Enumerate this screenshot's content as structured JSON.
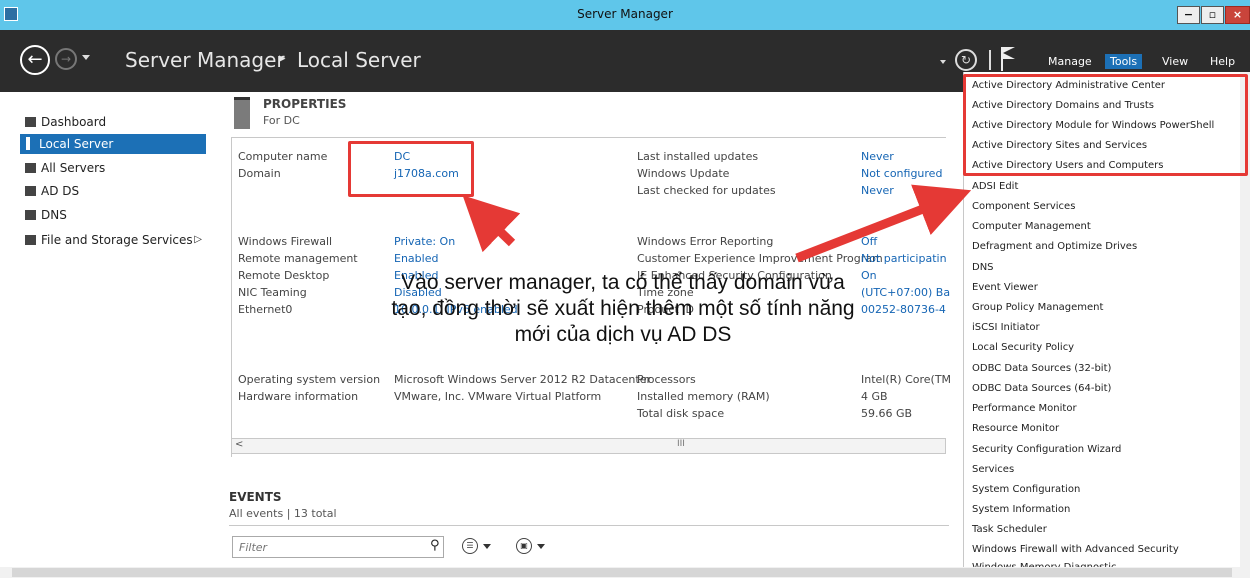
{
  "window": {
    "title": "Server Manager",
    "min": "−",
    "max": "▫",
    "close": "×"
  },
  "header": {
    "breadcrumb_root": "Server Manager",
    "breadcrumb_sep": "▸",
    "breadcrumb_page": "Local Server",
    "menus": [
      "Manage",
      "Tools",
      "View",
      "Help"
    ]
  },
  "sidebar": {
    "items": [
      {
        "label": "Dashboard",
        "icon": "dashboard-icon"
      },
      {
        "label": "Local Server",
        "icon": "server-icon",
        "active": true
      },
      {
        "label": "All Servers",
        "icon": "servers-icon"
      },
      {
        "label": "AD DS",
        "icon": "ad-ds-icon"
      },
      {
        "label": "DNS",
        "icon": "dns-icon"
      },
      {
        "label": "File and Storage Services",
        "icon": "storage-icon",
        "arrow": "▷"
      }
    ]
  },
  "properties": {
    "title": "PROPERTIES",
    "subtitle": "For DC",
    "left": [
      {
        "label": "Computer name",
        "value": "DC"
      },
      {
        "label": "Domain",
        "value": "j1708a.com"
      },
      {
        "label": "Windows Firewall",
        "value": "Private: On"
      },
      {
        "label": "Remote management",
        "value": "Enabled"
      },
      {
        "label": "Remote Desktop",
        "value": "Enabled"
      },
      {
        "label": "NIC Teaming",
        "value": "Disabled"
      },
      {
        "label": "Ethernet0",
        "value": "10.0.0.1, IPv6 enabled"
      },
      {
        "label": "Operating system version",
        "value": "Microsoft Windows Server 2012 R2 Datacenter"
      },
      {
        "label": "Hardware information",
        "value": "VMware, Inc. VMware Virtual Platform"
      }
    ],
    "right": [
      {
        "label": "Last installed updates",
        "value": "Never"
      },
      {
        "label": "Windows Update",
        "value": "Not configured"
      },
      {
        "label": "Last checked for updates",
        "value": "Never"
      },
      {
        "label": "Windows Error Reporting",
        "value": "Off"
      },
      {
        "label": "Customer Experience Improvement Program",
        "value": "Not participatin"
      },
      {
        "label": "IE Enhanced Security Configuration",
        "value": "On"
      },
      {
        "label": "Time zone",
        "value": "(UTC+07:00) Ba"
      },
      {
        "label": "Product ID",
        "value": "00252-80736-4"
      },
      {
        "label": "Processors",
        "value": "Intel(R) Core(TM"
      },
      {
        "label": "Installed memory (RAM)",
        "value": "4 GB"
      },
      {
        "label": "Total disk space",
        "value": "59.66 GB"
      }
    ],
    "scroll_left": "<",
    "scroll_mid": "III"
  },
  "events": {
    "title": "EVENTS",
    "subtitle": "All events | 13 total",
    "filter_placeholder": "Filter"
  },
  "tools_menu": [
    "Active Directory Administrative Center",
    "Active Directory Domains and Trusts",
    "Active Directory Module for Windows PowerShell",
    "Active Directory Sites and Services",
    "Active Directory Users and Computers",
    "ADSI Edit",
    "Component Services",
    "Computer Management",
    "Defragment and Optimize Drives",
    "DNS",
    "Event Viewer",
    "Group Policy Management",
    "iSCSI Initiator",
    "Local Security Policy",
    "ODBC Data Sources (32-bit)",
    "ODBC Data Sources (64-bit)",
    "Performance Monitor",
    "Resource Monitor",
    "Security Configuration Wizard",
    "Services",
    "System Configuration",
    "System Information",
    "Task Scheduler",
    "Windows Firewall with Advanced Security",
    "Windows Memory Diagnostic"
  ],
  "annotation": {
    "text": "Vào server manager, ta có thể thấy domain vừa tạo, đồng thời sẽ xuất hiện thêm một số tính năng mới của dịch vụ AD DS"
  },
  "colors": {
    "titlebar": "#5fc6ea",
    "header": "#2c2c2c",
    "accent": "#1c70b6",
    "link": "#1565b4",
    "highlight": "#e53935"
  }
}
